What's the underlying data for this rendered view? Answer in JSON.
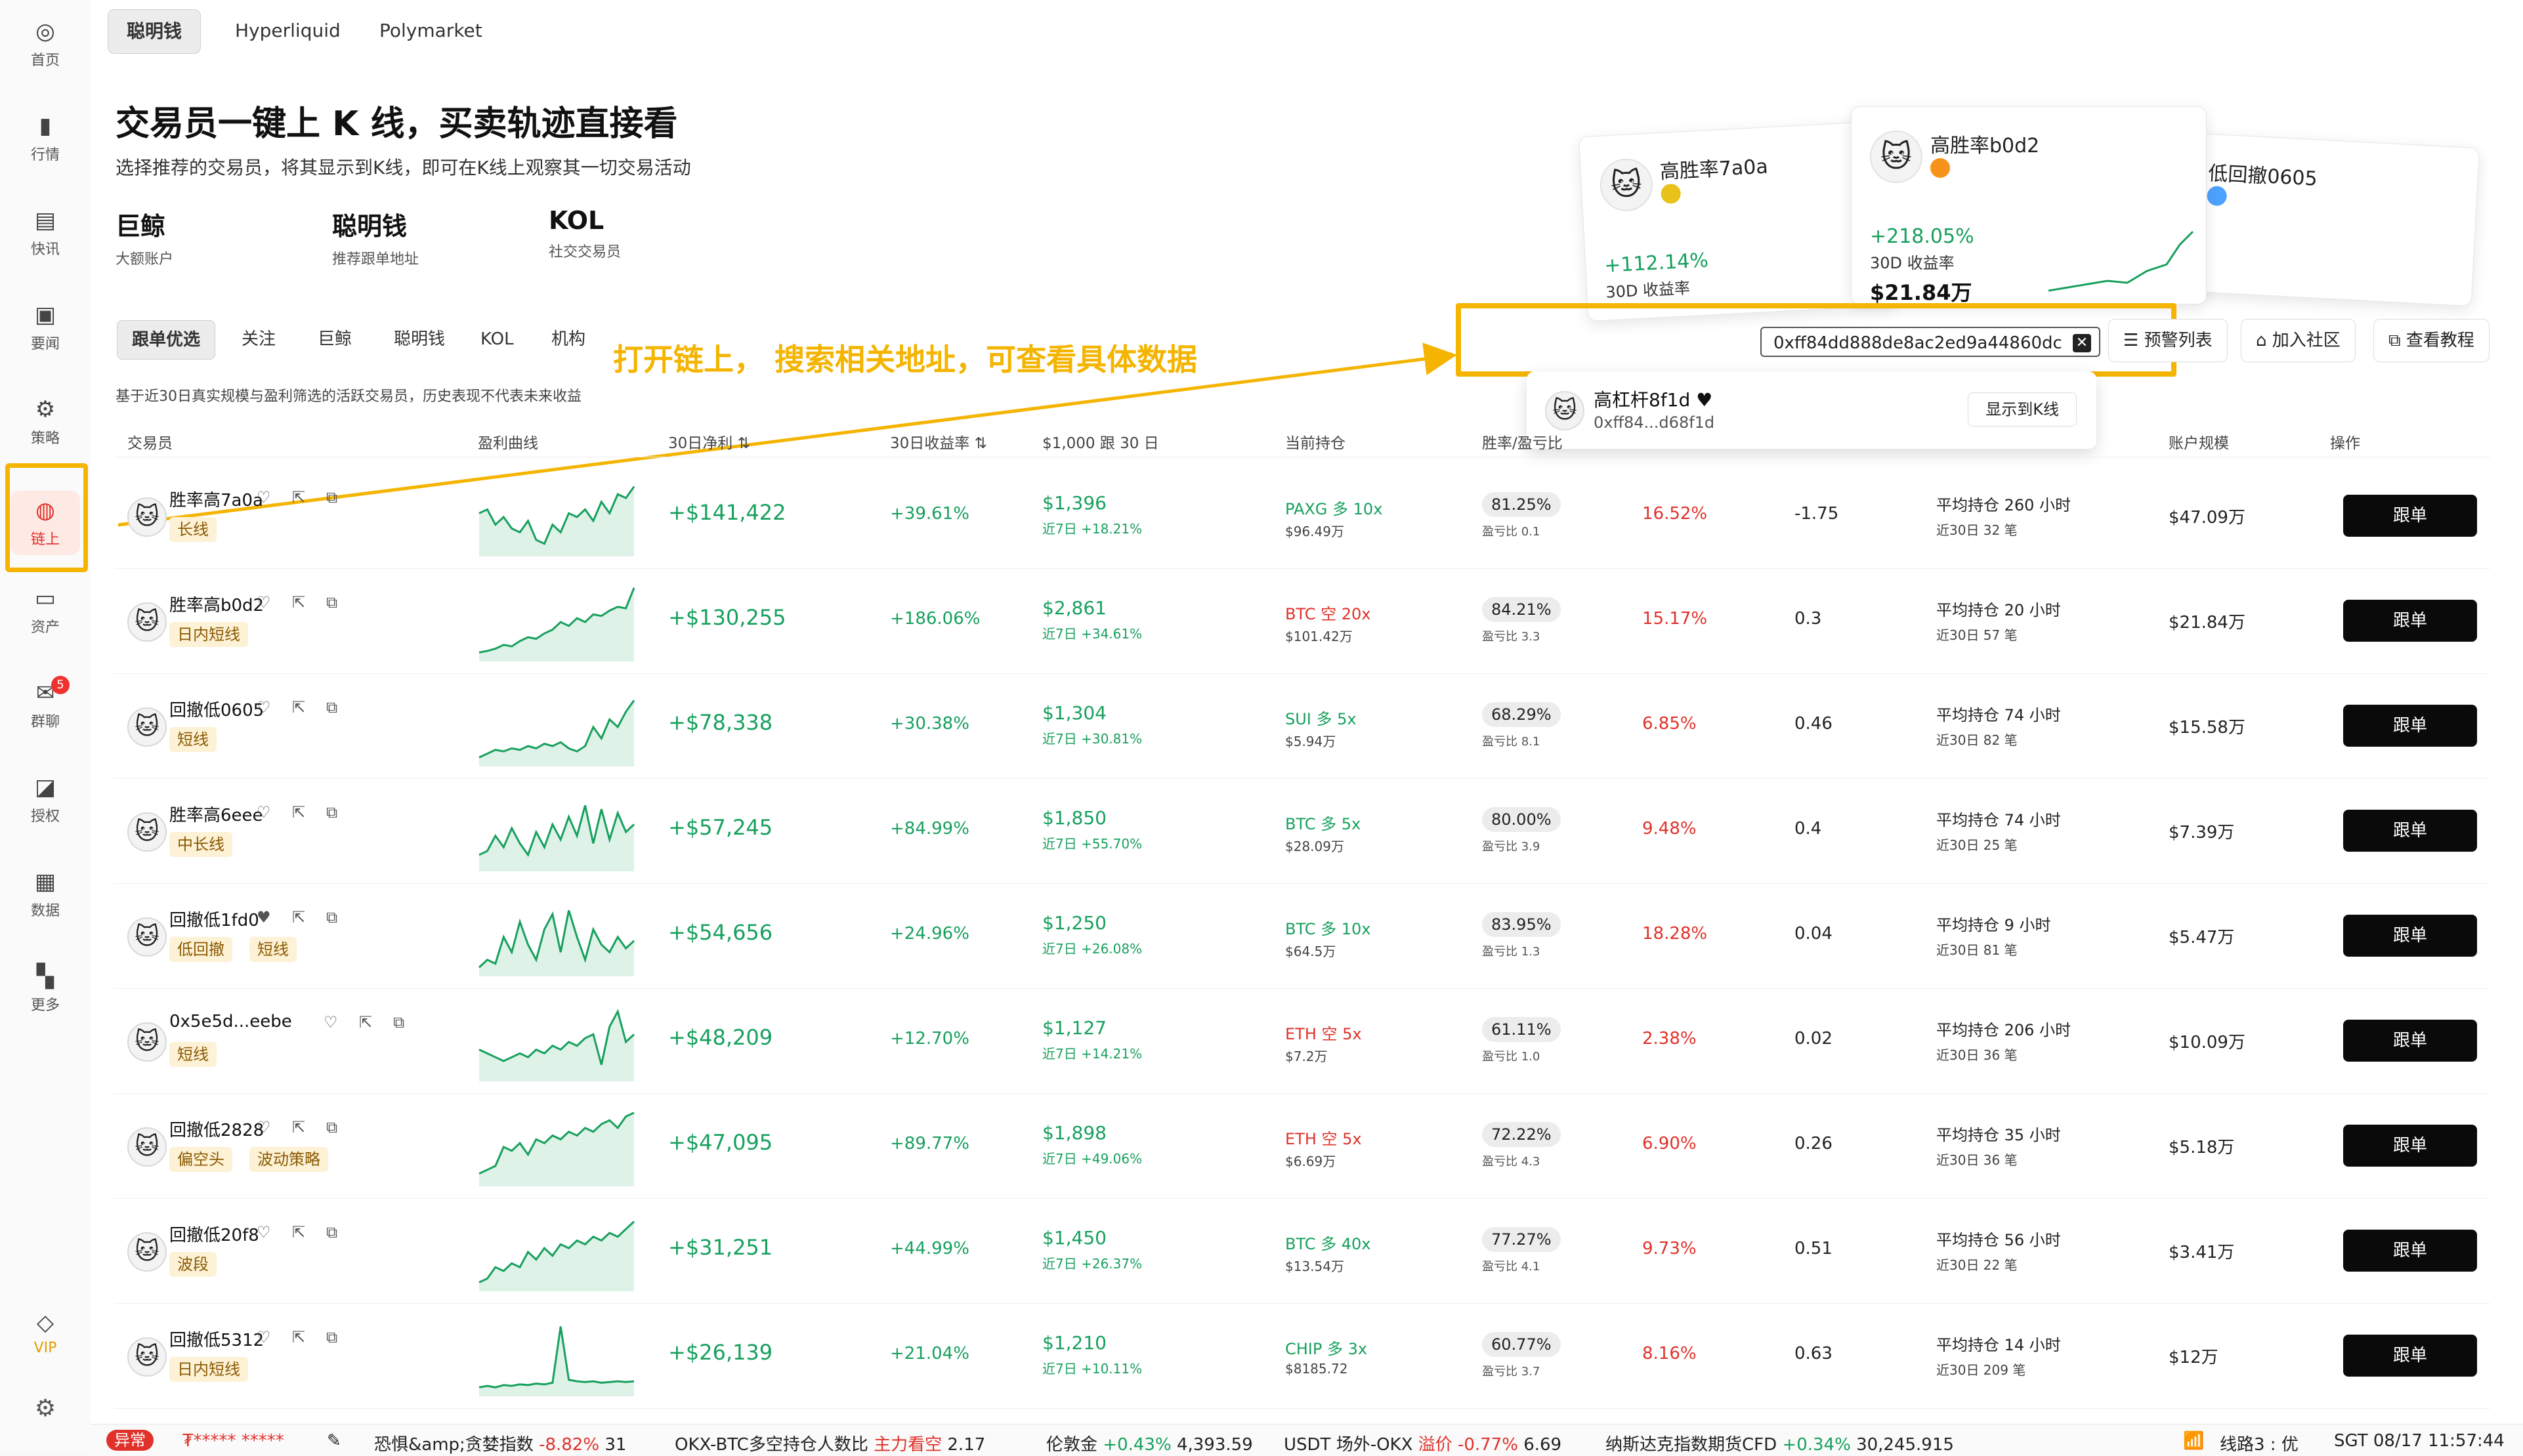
{
  "sidebar": {
    "items": [
      {
        "label": "首页",
        "icon": "home-icon"
      },
      {
        "label": "行情",
        "icon": "market-chart-icon"
      },
      {
        "label": "快讯",
        "icon": "news-flash-icon"
      },
      {
        "label": "要闻",
        "icon": "headline-doc-icon"
      },
      {
        "label": "策略",
        "icon": "robot-icon"
      },
      {
        "label": "链上",
        "icon": "onchain-icon",
        "active": true
      },
      {
        "label": "资产",
        "icon": "wallet-icon"
      },
      {
        "label": "群聊",
        "icon": "chat-icon",
        "badge": "5"
      },
      {
        "label": "授权",
        "icon": "authorize-icon"
      },
      {
        "label": "数据",
        "icon": "data-icon"
      },
      {
        "label": "更多",
        "icon": "more-grid-icon"
      }
    ],
    "vip_label": "VIP"
  },
  "top_tabs": [
    "聪明钱",
    "Hyperliquid",
    "Polymarket"
  ],
  "hero": {
    "title": "交易员一键上 K 线，买卖轨迹直接看",
    "subtitle": "选择推荐的交易员，将其显示到K线，即可在K线上观察其一切交易活动",
    "categories": [
      {
        "title": "巨鲸",
        "desc": "大额账户"
      },
      {
        "title": "聪明钱",
        "desc": "推荐跟单地址"
      },
      {
        "title": "KOL",
        "desc": "社交交易员"
      }
    ]
  },
  "preview_cards": [
    {
      "name": "高胜率7a0a",
      "pct": "+112.14%",
      "label": "30D 收益率",
      "amount": "",
      "coin_color": "#e8c21a"
    },
    {
      "name": "高胜率b0d2",
      "pct": "+218.05%",
      "label": "30D 收益率",
      "amount": "$21.84万",
      "coin_color": "#f7931a"
    },
    {
      "name": "低回撤0605",
      "pct": "",
      "label": "",
      "amount": "",
      "coin_color": "#4da2ff"
    }
  ],
  "filter_tabs": [
    "跟单优选",
    "关注",
    "巨鲸",
    "聪明钱",
    "KOL",
    "机构"
  ],
  "annotation": "打开链上， 搜索相关地址，可查看具体数据",
  "search": {
    "value": "0xff84dd888de8ac2ed9a44860dc",
    "clear": "✕"
  },
  "right_buttons": [
    "预警列表",
    "加入社区",
    "查看教程"
  ],
  "dropdown": {
    "name": "高杠杆8f1d",
    "address": "0xff84...d68f1d",
    "button": "显示到K线"
  },
  "note": "基于近30日真实规模与盈利筛选的活跃交易员，历史表现不代表未来收益",
  "headers": [
    "交易员",
    "盈利曲线",
    "30日净利",
    "30日收益率",
    "$1,000 跟 30 日",
    "当前持仓",
    "胜率/盈亏比",
    "",
    "",
    "",
    "账户规模",
    "操作"
  ],
  "rows": [
    {
      "name": "胜率高7a0a",
      "tags": [
        "长线"
      ],
      "pnl": "+$141,422",
      "roi": "+39.61%",
      "follow_val": "$1,396",
      "follow_sub": "近7日 +18.21%",
      "hold": "PAXG 多 10x",
      "hold_color": "#17a05d",
      "hold_sub": "$96.49万",
      "win": "81.25%",
      "win_sub": "盈亏比 0.1",
      "dd": "16.52%",
      "ratio": "-1.75",
      "avg": "平均持仓 260 小时",
      "avg_sub": "近30日 32 笔",
      "size": "$47.09万",
      "btn": "跟单",
      "liked": false,
      "spark": [
        0.55,
        0.6,
        0.4,
        0.5,
        0.35,
        0.3,
        0.45,
        0.2,
        0.15,
        0.4,
        0.3,
        0.55,
        0.5,
        0.6,
        0.45,
        0.7,
        0.55,
        0.8,
        0.75,
        0.9
      ]
    },
    {
      "name": "胜率高b0d2",
      "tags": [
        "日内短线"
      ],
      "pnl": "+$130,255",
      "roi": "+186.06%",
      "follow_val": "$2,861",
      "follow_sub": "近7日 +34.61%",
      "hold": "BTC 空 20x",
      "hold_color": "#e0312a",
      "hold_sub": "$101.42万",
      "win": "84.21%",
      "win_sub": "盈亏比 3.3",
      "dd": "15.17%",
      "ratio": "0.3",
      "avg": "平均持仓 20 小时",
      "avg_sub": "近30日 57 笔",
      "size": "$21.84万",
      "btn": "跟单",
      "liked": false,
      "spark": [
        0.1,
        0.12,
        0.15,
        0.2,
        0.18,
        0.25,
        0.3,
        0.28,
        0.35,
        0.4,
        0.5,
        0.45,
        0.55,
        0.5,
        0.6,
        0.58,
        0.65,
        0.7,
        0.68,
        0.95
      ]
    },
    {
      "name": "回撤低0605",
      "tags": [
        "短线"
      ],
      "pnl": "+$78,338",
      "roi": "+30.38%",
      "follow_val": "$1,304",
      "follow_sub": "近7日 +30.81%",
      "hold": "SUI 多 5x",
      "hold_color": "#17a05d",
      "hold_sub": "$5.94万",
      "win": "68.29%",
      "win_sub": "盈亏比 8.1",
      "dd": "6.85%",
      "ratio": "0.46",
      "avg": "平均持仓 74 小时",
      "avg_sub": "近30日 82 笔",
      "size": "$15.58万",
      "btn": "跟单",
      "liked": false,
      "spark": [
        0.1,
        0.15,
        0.2,
        0.18,
        0.22,
        0.2,
        0.25,
        0.22,
        0.28,
        0.25,
        0.3,
        0.22,
        0.18,
        0.25,
        0.5,
        0.35,
        0.6,
        0.5,
        0.7,
        0.85
      ]
    },
    {
      "name": "胜率高6eee",
      "tags": [
        "中长线"
      ],
      "pnl": "+$57,245",
      "roi": "+84.99%",
      "follow_val": "$1,850",
      "follow_sub": "近7日 +55.70%",
      "hold": "BTC 多 5x",
      "hold_color": "#17a05d",
      "hold_sub": "$28.09万",
      "win": "80.00%",
      "win_sub": "盈亏比 3.9",
      "dd": "9.48%",
      "ratio": "0.4",
      "avg": "平均持仓 74 小时",
      "avg_sub": "近30日 25 笔",
      "size": "$7.39万",
      "btn": "跟单",
      "liked": false,
      "spark": [
        0.2,
        0.25,
        0.45,
        0.3,
        0.55,
        0.35,
        0.2,
        0.5,
        0.3,
        0.6,
        0.4,
        0.7,
        0.45,
        0.85,
        0.35,
        0.8,
        0.4,
        0.75,
        0.5,
        0.6
      ]
    },
    {
      "name": "回撤低1fd0",
      "tags": [
        "低回撤",
        "短线"
      ],
      "pnl": "+$54,656",
      "roi": "+24.96%",
      "follow_val": "$1,250",
      "follow_sub": "近7日 +26.08%",
      "hold": "BTC 多 10x",
      "hold_color": "#17a05d",
      "hold_sub": "$64.5万",
      "win": "83.95%",
      "win_sub": "盈亏比 1.3",
      "dd": "18.28%",
      "ratio": "0.04",
      "avg": "平均持仓 9 小时",
      "avg_sub": "近30日 81 笔",
      "size": "$5.47万",
      "btn": "跟单",
      "liked": true,
      "spark": [
        0.1,
        0.2,
        0.15,
        0.5,
        0.3,
        0.7,
        0.4,
        0.2,
        0.6,
        0.8,
        0.3,
        0.85,
        0.5,
        0.2,
        0.6,
        0.4,
        0.3,
        0.5,
        0.35,
        0.45
      ]
    },
    {
      "name": "0x5e5d...eebe",
      "tags": [
        "短线"
      ],
      "pnl": "+$48,209",
      "roi": "+12.70%",
      "follow_val": "$1,127",
      "follow_sub": "近7日 +14.21%",
      "hold": "ETH 空 5x",
      "hold_color": "#e0312a",
      "hold_sub": "$7.2万",
      "win": "61.11%",
      "win_sub": "盈亏比 1.0",
      "dd": "2.38%",
      "ratio": "0.02",
      "avg": "平均持仓 206 小时",
      "avg_sub": "近30日 36 笔",
      "size": "$10.09万",
      "btn": "跟单",
      "liked": false,
      "spark": [
        0.4,
        0.35,
        0.3,
        0.25,
        0.3,
        0.35,
        0.3,
        0.4,
        0.35,
        0.45,
        0.4,
        0.5,
        0.45,
        0.55,
        0.6,
        0.2,
        0.7,
        0.9,
        0.5,
        0.6
      ]
    },
    {
      "name": "回撤低2828",
      "tags": [
        "偏空头",
        "波动策略"
      ],
      "pnl": "+$47,095",
      "roi": "+89.77%",
      "follow_val": "$1,898",
      "follow_sub": "近7日 +49.06%",
      "hold": "ETH 空 5x",
      "hold_color": "#e0312a",
      "hold_sub": "$6.69万",
      "win": "72.22%",
      "win_sub": "盈亏比 4.3",
      "dd": "6.90%",
      "ratio": "0.26",
      "avg": "平均持仓 35 小时",
      "avg_sub": "近30日 36 笔",
      "size": "$5.18万",
      "btn": "跟单",
      "liked": false,
      "spark": [
        0.15,
        0.2,
        0.25,
        0.5,
        0.45,
        0.55,
        0.4,
        0.6,
        0.55,
        0.65,
        0.6,
        0.7,
        0.65,
        0.75,
        0.7,
        0.8,
        0.85,
        0.75,
        0.9,
        0.95
      ]
    },
    {
      "name": "回撤低20f8",
      "tags": [
        "波段"
      ],
      "pnl": "+$31,251",
      "roi": "+44.99%",
      "follow_val": "$1,450",
      "follow_sub": "近7日 +26.37%",
      "hold": "BTC 多 40x",
      "hold_color": "#17a05d",
      "hold_sub": "$13.54万",
      "win": "77.27%",
      "win_sub": "盈亏比 4.1",
      "dd": "9.73%",
      "ratio": "0.51",
      "avg": "平均持仓 56 小时",
      "avg_sub": "近30日 22 笔",
      "size": "$3.41万",
      "btn": "跟单",
      "liked": false,
      "spark": [
        0.1,
        0.15,
        0.3,
        0.25,
        0.35,
        0.3,
        0.5,
        0.4,
        0.55,
        0.45,
        0.6,
        0.55,
        0.65,
        0.6,
        0.7,
        0.65,
        0.75,
        0.7,
        0.8,
        0.9
      ]
    },
    {
      "name": "回撤低5312",
      "tags": [
        "日内短线"
      ],
      "pnl": "+$26,139",
      "roi": "+21.04%",
      "follow_val": "$1,210",
      "follow_sub": "近7日 +10.11%",
      "hold": "CHIP 多 3x",
      "hold_color": "#17a05d",
      "hold_sub": "$8185.72",
      "win": "60.77%",
      "win_sub": "盈亏比 3.7",
      "dd": "8.16%",
      "ratio": "0.63",
      "avg": "平均持仓 14 小时",
      "avg_sub": "近30日 209 笔",
      "size": "$12万",
      "btn": "跟单",
      "liked": false,
      "spark": [
        0.1,
        0.12,
        0.1,
        0.13,
        0.12,
        0.14,
        0.13,
        0.15,
        0.14,
        0.16,
        0.9,
        0.2,
        0.18,
        0.17,
        0.18,
        0.16,
        0.17,
        0.18,
        0.17,
        0.18
      ]
    }
  ],
  "ticker": {
    "status": "异常",
    "masked": "₮*****  *****",
    "items": [
      {
        "label": "恐惧&amp;贪婪指数",
        "change": "-8.82%",
        "dir": "down",
        "value": "31"
      },
      {
        "label": "OKX-BTC多空持仓人数比",
        "change": "主力看空",
        "dir": "down",
        "value": "2.17"
      },
      {
        "label": "伦敦金",
        "change": "+0.43%",
        "dir": "up",
        "value": "4,393.59"
      },
      {
        "label": "USDT 场外-OKX",
        "change": "溢价 -0.77%",
        "dir": "down",
        "value": "6.69"
      },
      {
        "label": "纳斯达克指数期货CFD",
        "change": "+0.34%",
        "dir": "up",
        "value": "30,245.915"
      }
    ],
    "line": "线路3 : 优",
    "time": "SGT 08/17 11:57:44"
  }
}
